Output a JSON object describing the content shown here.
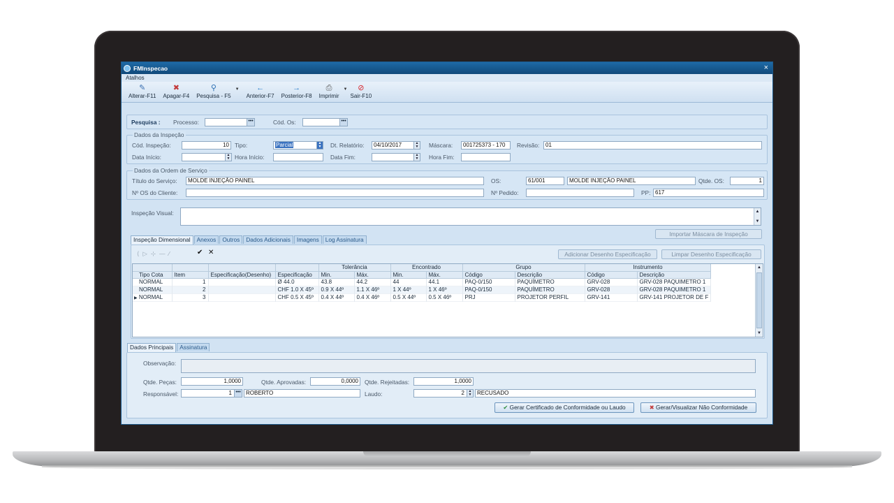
{
  "window": {
    "title": "FMInspecao",
    "close": "×"
  },
  "menu": {
    "atalhos": "Atalhos"
  },
  "toolbar": [
    {
      "label": "Alterar-F11",
      "icon": "✎"
    },
    {
      "label": "Apagar-F4",
      "icon": "✖"
    },
    {
      "label": "Pesquisa - F5",
      "icon": "⚲"
    },
    {
      "label": "Anterior-F7",
      "icon": "←"
    },
    {
      "label": "Posterior-F8",
      "icon": "→"
    },
    {
      "label": "Imprimir",
      "icon": "⎙"
    },
    {
      "label": "Sair-F10",
      "icon": "⊘"
    }
  ],
  "pesquisa": {
    "label": "Pesquisa :",
    "processo_label": "Processo:",
    "cod_os_label": "Cód. Os:"
  },
  "inspecao": {
    "legend": "Dados da Inspeção",
    "cod_label": "Cód. Inspeção:",
    "cod_value": "10",
    "tipo_label": "Tipo:",
    "tipo_value": "Parcial",
    "dt_label": "Dt. Relatório:",
    "dt_value": "04/10/2017",
    "mascara_label": "Máscara:",
    "mascara_value": "001725373 - 170",
    "revisao_label": "Revisão:",
    "revisao_value": "01",
    "data_inicio_label": "Data Início:",
    "hora_inicio_label": "Hora Início:",
    "data_fim_label": "Data Fim:",
    "hora_fim_label": "Hora Fim:"
  },
  "os": {
    "legend": "Dados da Ordem de Serviço",
    "titulo_label": "Título do Serviço:",
    "titulo_value": "MOLDE INJEÇÃO PAINEL",
    "os_label": "OS:",
    "os_value": "61/001",
    "os_desc": "MOLDE INJEÇÃO PAINEL",
    "qtde_label": "Qtde. OS:",
    "qtde_value": "1",
    "cliente_label": "Nº OS do Cliente:",
    "pedido_label": "Nº Pedido:",
    "pp_label": "PP:",
    "pp_value": "617"
  },
  "visual": {
    "label": "Inspeção Visual:"
  },
  "tabs_top": [
    "Inspeção Dimensional",
    "Anexos",
    "Outros",
    "Dados Adicionais",
    "Imagens",
    "Log Assinatura"
  ],
  "buttons": {
    "importar": "Importar Máscara de Inspeção",
    "adicionar": "Adicionar Desenho Especificação",
    "limpar": "Limpar Desenho Especificação",
    "gerar_cert": "Gerar Certificado de Conformidade ou Laudo",
    "gerar_nc": "Gerar/Visualizar Não Conformidade"
  },
  "grid": {
    "group_headers": {
      "tolerancia": "Tolerância",
      "encontrado": "Encontrado",
      "grupo": "Grupo",
      "instrumento": "Instrumento"
    },
    "columns": [
      "Tipo Cota",
      "Item",
      "Especificação(Desenho)",
      "Especificação",
      "Min.",
      "Máx.",
      "Min.",
      "Máx.",
      "Código",
      "Descrição",
      "Código",
      "Descrição"
    ],
    "rows": [
      [
        "NORMAL",
        "1",
        "",
        "Ø 44.0",
        "43.8",
        "44.2",
        "44",
        "44.1",
        "PAQ-0/150",
        "PAQUÍMETRO",
        "GRV-028",
        "GRV-028 PAQUIMETRO 1"
      ],
      [
        "NORMAL",
        "2",
        "",
        "CHF 1.0 X 45º",
        "0.9 X 44º",
        "1.1 X 46º",
        "1 X 44º",
        "1 X 46º",
        "PAQ-0/150",
        "PAQUÍMETRO",
        "GRV-028",
        "GRV-028 PAQUIMETRO 1"
      ],
      [
        "NORMAL",
        "3",
        "",
        "CHF 0.5 X 45º",
        "0.4 X 44º",
        "0.4 X 46º",
        "0.5 X 44º",
        "0.5 X 46º",
        "PRJ",
        "PROJETOR PERFIL",
        "GRV-141",
        "GRV-141 PROJETOR DE F"
      ]
    ]
  },
  "tabs_bottom": [
    "Dados Principais",
    "Assinatura"
  ],
  "principais": {
    "obs_label": "Observação:",
    "pecas_label": "Qtde. Peças:",
    "pecas_value": "1,0000",
    "aprov_label": "Qtde. Aprovadas:",
    "aprov_value": "0,0000",
    "rej_label": "Qtde. Rejeitadas:",
    "rej_value": "1,0000",
    "resp_label": "Responsável:",
    "resp_code": "1",
    "resp_name": "ROBERTO",
    "laudo_label": "Laudo:",
    "laudo_code": "2",
    "laudo_value": "RECUSADO"
  }
}
